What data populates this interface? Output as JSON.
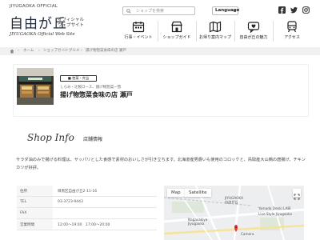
{
  "header": {
    "brand_en": "JIYUGAOKA OFFICIAL",
    "logo": "自由が丘",
    "logo_sub_1": "オフィシャル",
    "logo_sub_2": "ウェブサイト",
    "tagline": "JIYUGAOKA Official Web Site",
    "search_placeholder": "ショップを検索",
    "language_label": "Language",
    "social": [
      "facebook-icon",
      "twitter-icon",
      "instagram-icon"
    ]
  },
  "nav": [
    {
      "label": "行事・イベント",
      "icon": "calendar-icon"
    },
    {
      "label": "ショップガイド",
      "icon": "shop-icon"
    },
    {
      "label": "お帰り案内マップ",
      "icon": "map-icon"
    },
    {
      "label": "自由が丘の魅力",
      "icon": "heart-icon"
    },
    {
      "label": "アクセス",
      "icon": "train-icon"
    }
  ],
  "breadcrumb": [
    "ホーム",
    "ショップガイド",
    "グルメ",
    "揚げ物惣菜食味の店 瀬戸"
  ],
  "shop": {
    "category": "■ 惣菜・弁当",
    "description": "しらみ・辻製ロース、揚げ物惣菜ー惣",
    "name": "揚げ物惣菜食味の店 瀬戸"
  },
  "shop_info": {
    "title_en": "Shop Info",
    "title_ja": "店舗情報",
    "description": "サラダ油のみで揚げる料理は、サッパリとした食感で素材のおいしさが引き立ちます。北海道産男爵いも使用のコロッケと、鳥取産大山鶏の唐揚げ、チキンカツが好評。"
  },
  "table": [
    {
      "key": "住所",
      "value": "目黒区自由が丘2-11-16"
    },
    {
      "key": "TEL",
      "value": "03-3723-9443"
    },
    {
      "key": "FAX",
      "value": ""
    },
    {
      "key": "営業時間",
      "value": "12:00～19:00　17:00～20:00"
    }
  ],
  "map": {
    "tab_map": "Map",
    "tab_satellite": "Satellite",
    "labels": [
      "JIYUGAOKA",
      "自由が丘",
      "Yamada Denki LABI",
      "Live Style Jiyugaoka",
      "Nagasakiya",
      "Jiyugaoka",
      "Camera"
    ]
  },
  "colors": {
    "navy": "#1f2a3a",
    "crumb_bg": "#f1f1f1",
    "map_pin": "#e53935"
  }
}
